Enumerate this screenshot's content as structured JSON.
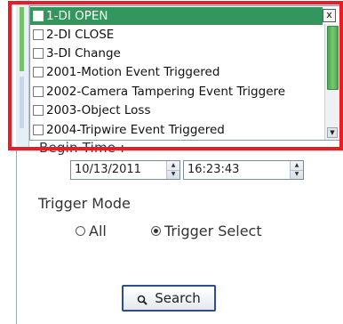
{
  "dropdown": {
    "items": [
      {
        "label": "1-DI OPEN",
        "selected": true
      },
      {
        "label": "2-DI CLOSE",
        "selected": false
      },
      {
        "label": "3-DI Change",
        "selected": false
      },
      {
        "label": "2001-Motion Event Triggered",
        "selected": false
      },
      {
        "label": "2002-Camera Tampering Event Triggere",
        "selected": false
      },
      {
        "label": "2003-Object Loss",
        "selected": false
      },
      {
        "label": "2004-Tripwire Event Triggered",
        "selected": false
      }
    ],
    "close_glyph": "x",
    "scroll_up_glyph": "▲",
    "scroll_down_glyph": "▼"
  },
  "begin_time": {
    "label": "Begin Time :",
    "date": "10/13/2011",
    "time": "16:23:43"
  },
  "spinner": {
    "up": "▲",
    "down": "▼"
  },
  "trigger": {
    "label": "Trigger Mode",
    "options": [
      {
        "label": "All",
        "checked": false
      },
      {
        "label": "Trigger Select",
        "checked": true
      }
    ]
  },
  "search": {
    "label": "Search"
  },
  "colors": {
    "selection": "#33975d",
    "highlight": "#ea1c24",
    "button_border": "#2f4d8a"
  }
}
